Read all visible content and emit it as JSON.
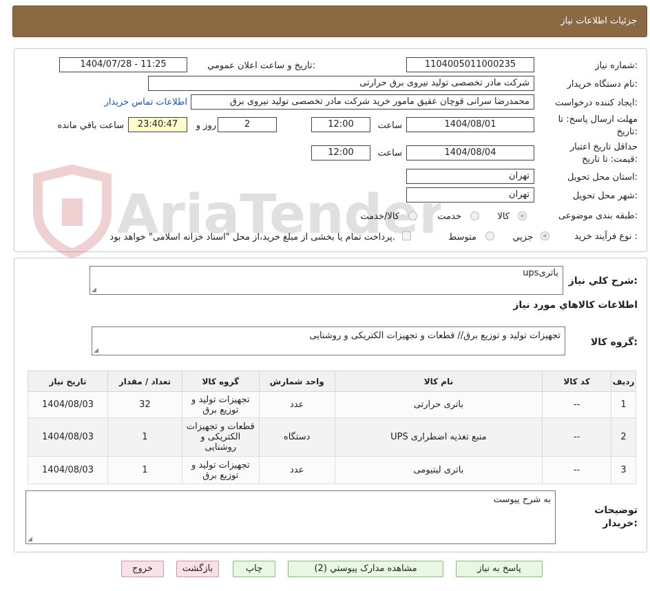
{
  "header": {
    "title": "جزئیات اطلاعات نیاز"
  },
  "form": {
    "need_number_label": "شماره نیاز:",
    "need_number": "1104005011000235",
    "announce_label": "تاریخ و ساعت اعلان عمومي:",
    "announce_value": "1404/07/28 - 11:25",
    "buyer_org_label": "نام دستگاه خریدار:",
    "buyer_org": "شرکت مادر تخصصی تولید نیروی برق حرارتی",
    "requester_label": "ایجاد کننده درخواست:",
    "requester": "محمدرضا سرانی قوچان عقیق مامور خرید شرکت مادر تخصصی تولید نیروی برق",
    "contact_link": "اطلاعات تماس خریدار",
    "deadline_label_1": "مهلت ارسال پاسخ: تا",
    "deadline_label_2": "تاریخ:",
    "deadline_date": "1404/08/01",
    "time_label": "ساعت",
    "deadline_time": "12:00",
    "days": "2",
    "days_label": "روز و",
    "remaining_time": "23:40:47",
    "remaining_label": "ساعت باقي مانده",
    "validity_label_1": "حداقل تاریخ اعتبار",
    "validity_label_2": "قیمت: تا تاریخ:",
    "validity_date": "1404/08/04",
    "validity_time": "12:00",
    "province_label": "استان محل تحویل:",
    "province": "تهران",
    "city_label": "شهر محل تحویل:",
    "city": "تهران",
    "category_label": "طبقه بندی موضوعی:",
    "category_options": [
      "کالا",
      "خدمت",
      "کالا/خدمت"
    ],
    "process_label": "نوع فرآیند خرید :",
    "process_options": [
      "جزيي",
      "متوسط"
    ],
    "payment_note": "پرداخت تمام یا بخشی از مبلغ خرید،از محل \"اسناد خزانه اسلامی\" خواهد بود."
  },
  "watermark": {
    "text": "AriaTender.neT"
  },
  "description": {
    "label": "شرح کلي نیاز:",
    "value": "باتریups"
  },
  "goods_info": {
    "title": "اطلاعات کالاهاي مورد نیاز",
    "group_label": "گروه کالا:",
    "group_value": "تجهیزات تولید و توزیع برق// قطعات و تجهیزات الکتریکی و روشنایی"
  },
  "table": {
    "headers": [
      "ردیف",
      "کد کالا",
      "نام کالا",
      "واحد شمارش",
      "گروه کالا",
      "تعداد / مقدار",
      "تاریخ نیاز"
    ],
    "rows": [
      [
        "1",
        "--",
        "باتری حرارتی",
        "عدد",
        "تجهیزات تولید و توزیع برق",
        "32",
        "1404/08/03"
      ],
      [
        "2",
        "--",
        "منبع تغذیه اضطراری UPS",
        "دستگاه",
        "قطعات و تجهیزات الکتریکی و روشنایی",
        "1",
        "1404/08/03"
      ],
      [
        "3",
        "--",
        "باتری لیتیومی",
        "عدد",
        "تجهیزات تولید و توزیع برق",
        "1",
        "1404/08/03"
      ]
    ]
  },
  "buyer_notes": {
    "label_1": "توضیحات",
    "label_2": "خریدار:",
    "value": "به شرح پیوست"
  },
  "buttons": {
    "reply": "پاسخ به نیاز",
    "attachments": "مشاهده مدارک پیوستي (2)",
    "print": "چاپ",
    "back": "بازگشت",
    "exit": "خروج"
  }
}
